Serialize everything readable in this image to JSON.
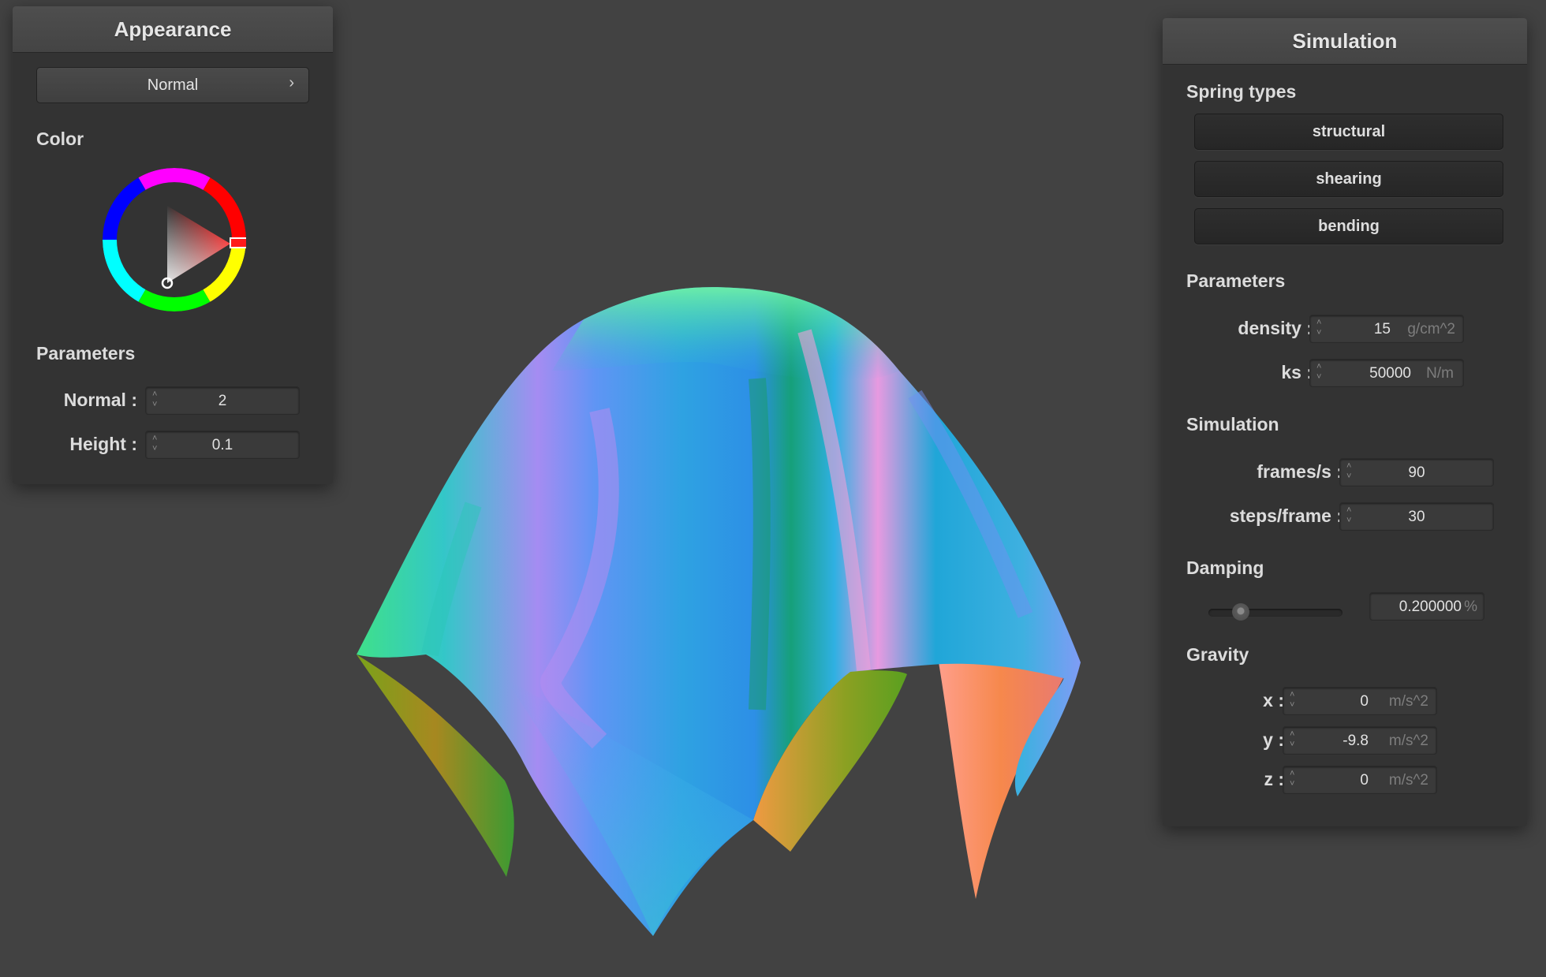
{
  "appearance": {
    "title": "Appearance",
    "mode_value": "Normal",
    "color_label": "Color",
    "params_label": "Parameters",
    "normal_label": "Normal :",
    "normal_value": "2",
    "height_label": "Height :",
    "height_value": "0.1"
  },
  "simulation": {
    "title": "Simulation",
    "spring_types_label": "Spring types",
    "springs": [
      "structural",
      "shearing",
      "bending"
    ],
    "params_label": "Parameters",
    "density_label": "density :",
    "density_value": "15",
    "density_unit": "g/cm^2",
    "ks_label": "ks :",
    "ks_value": "50000",
    "ks_unit": "N/m",
    "sim_label": "Simulation",
    "fps_label": "frames/s :",
    "fps_value": "90",
    "steps_label": "steps/frame :",
    "steps_value": "30",
    "damping_label": "Damping",
    "damping_value": "0.200000",
    "damping_unit": "%",
    "damping_fraction": 0.2,
    "gravity_label": "Gravity",
    "gx_label": "x :",
    "gx_value": "0",
    "gy_label": "y :",
    "gy_value": "-9.8",
    "gz_label": "z :",
    "gz_value": "0",
    "gravity_unit": "m/s^2"
  },
  "colors": {
    "background": "#424242",
    "panel": "#333333",
    "selected_color": "#ff1a1a"
  }
}
